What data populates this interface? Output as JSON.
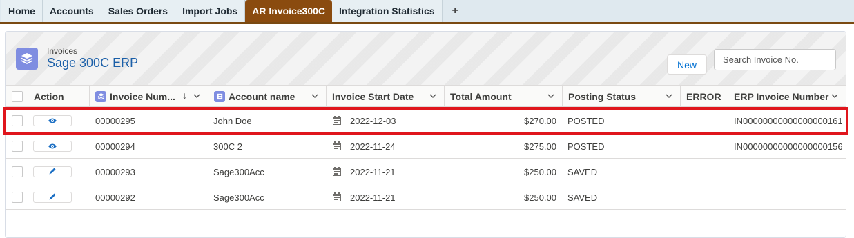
{
  "tabs": [
    {
      "label": "Home",
      "active": false
    },
    {
      "label": "Accounts",
      "active": false
    },
    {
      "label": "Sales Orders",
      "active": false
    },
    {
      "label": "Import Jobs",
      "active": false
    },
    {
      "label": "AR Invoice300C",
      "active": true
    },
    {
      "label": "Integration Statistics",
      "active": false
    }
  ],
  "add_tab": "+",
  "header": {
    "object_label": "Invoices",
    "title": "Sage 300C ERP",
    "new_button": "New",
    "search_placeholder": "Search Invoice No."
  },
  "columns": {
    "action": "Action",
    "invoice_number": "Invoice Num...",
    "account_name": "Account name",
    "invoice_start_date": "Invoice Start Date",
    "total_amount": "Total Amount",
    "posting_status": "Posting Status",
    "error": "ERROR",
    "erp_invoice_number": "ERP Invoice Number"
  },
  "rows": [
    {
      "action_icon": "eye-icon",
      "invoice_number": "00000295",
      "account_name": "John Doe",
      "invoice_start_date": "2022-12-03",
      "total_amount": "$270.00",
      "posting_status": "POSTED",
      "error": "",
      "erp_invoice_number": "IN00000000000000000161"
    },
    {
      "action_icon": "eye-icon",
      "invoice_number": "00000294",
      "account_name": "300C 2",
      "invoice_start_date": "2022-11-24",
      "total_amount": "$275.00",
      "posting_status": "POSTED",
      "error": "",
      "erp_invoice_number": "IN00000000000000000156"
    },
    {
      "action_icon": "pencil-icon",
      "invoice_number": "00000293",
      "account_name": "Sage300Acc",
      "invoice_start_date": "2022-11-21",
      "total_amount": "$250.00",
      "posting_status": "SAVED",
      "error": "",
      "erp_invoice_number": ""
    },
    {
      "action_icon": "pencil-icon",
      "invoice_number": "00000292",
      "account_name": "Sage300Acc",
      "invoice_start_date": "2022-11-21",
      "total_amount": "$250.00",
      "posting_status": "SAVED",
      "error": "",
      "erp_invoice_number": ""
    }
  ],
  "colors": {
    "active_tab": "#8a4b0f",
    "highlight": "#e0161d",
    "link": "#1b5fa8",
    "icon_bg": "#7f8de1",
    "action_icon": "#1b6fc4"
  }
}
